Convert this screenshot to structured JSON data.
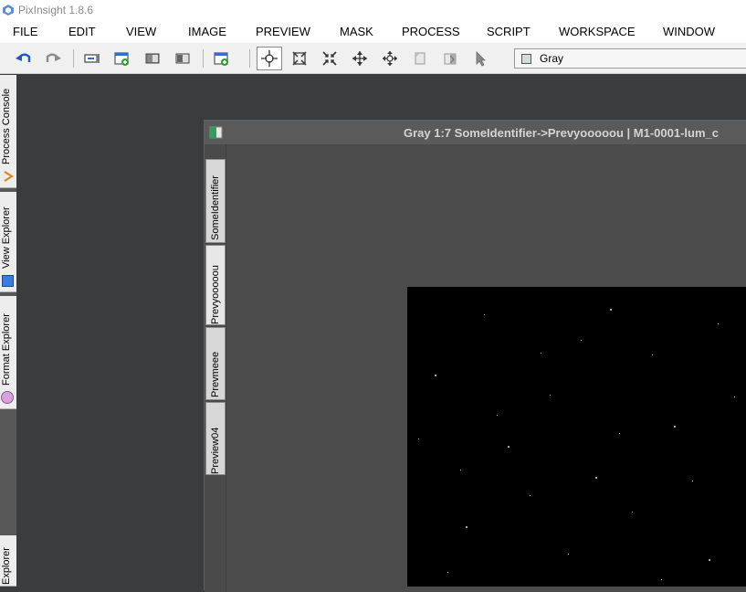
{
  "app": {
    "title": "PixInsight 1.8.6"
  },
  "menu": [
    "FILE",
    "EDIT",
    "VIEW",
    "IMAGE",
    "PREVIEW",
    "MASK",
    "PROCESS",
    "SCRIPT",
    "WORKSPACE",
    "WINDOW"
  ],
  "toolbar": {
    "view_selector": "Gray",
    "buttons": [
      "undo",
      "redo",
      "image-info",
      "new-image",
      "duplicate",
      "mask",
      "new-preview",
      "readout-mode",
      "zoom-fit",
      "zoom-actual",
      "zoom-fit-window",
      "pan",
      "edit-preview",
      "delete-preview",
      "select-pointer"
    ]
  },
  "left_panel": {
    "tabs": [
      "Process Console",
      "View Explorer",
      "Format Explorer",
      "Explorer"
    ]
  },
  "image_window": {
    "title": "Gray 1:7 SomeIdentifier->Prevyooooou | M1-0001-lum_c",
    "preview_tabs": [
      "SomeIdentifier",
      "Prevyooooou",
      "Prevmeee",
      "Preview04"
    ]
  },
  "colors": {
    "workspace": "#3a3c3d",
    "image_window": "#4d4d4d",
    "image": "#000000"
  }
}
